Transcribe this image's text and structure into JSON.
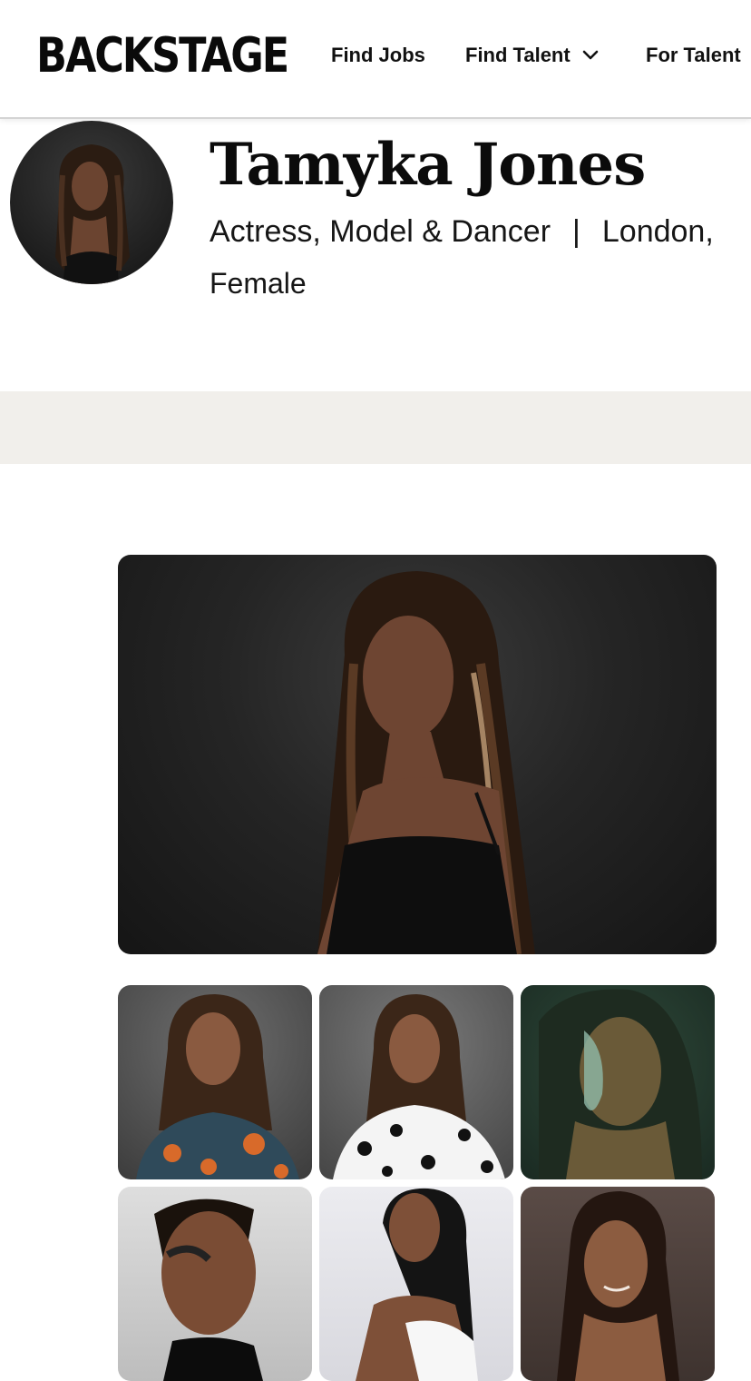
{
  "header": {
    "logo": "BACKSTAGE",
    "nav": [
      {
        "label": "Find Jobs"
      },
      {
        "label": "Find Talent",
        "has_dropdown": true,
        "icon": "chevron-down-icon"
      },
      {
        "label": "For Talent"
      }
    ]
  },
  "profile": {
    "name": "Tamyka Jones",
    "roles": "Actress, Model & Dancer",
    "separator": "|",
    "location": "London,",
    "gender": "Female"
  },
  "gallery": {
    "hero": {
      "description_icon": "headshot-photo"
    },
    "thumbnails": [
      {
        "style": "floral-blouse"
      },
      {
        "style": "polka-dot-blouse"
      },
      {
        "style": "glitter-makeup"
      },
      {
        "style": "editorial-makeup"
      },
      {
        "style": "white-top"
      },
      {
        "style": "glam-portrait"
      }
    ]
  },
  "colors": {
    "band": "#f1efeb",
    "text": "#111111",
    "photo_dark": "#1a1a1a"
  }
}
